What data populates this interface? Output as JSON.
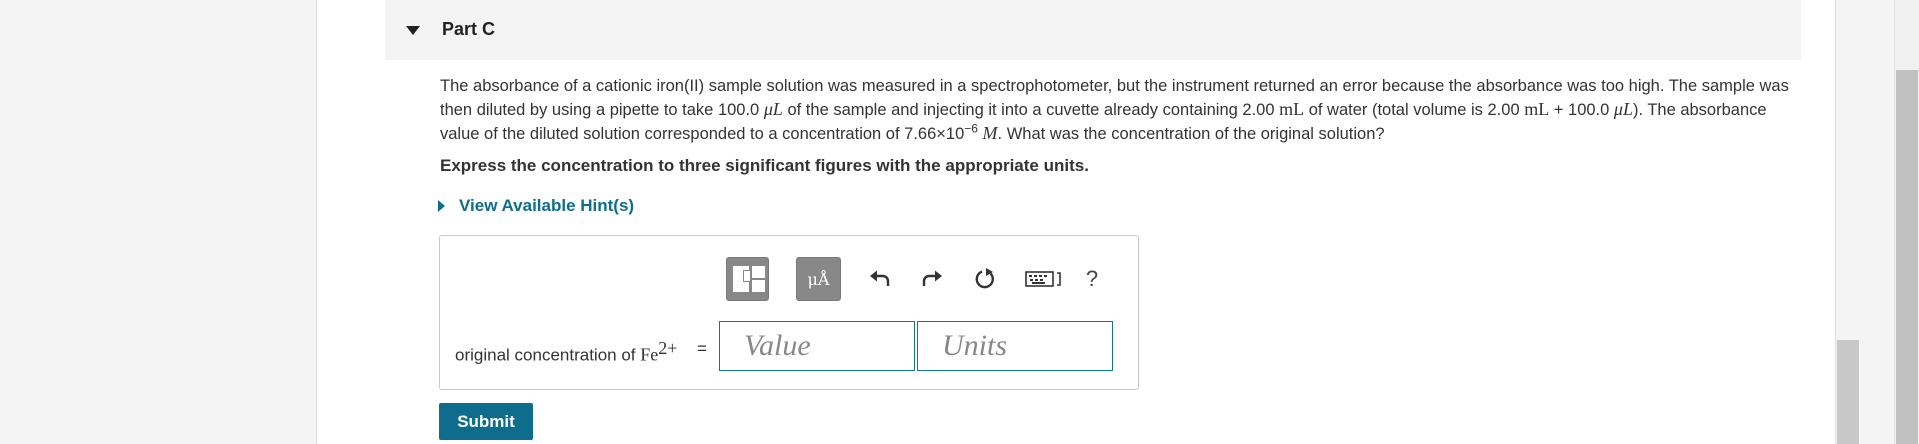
{
  "part": {
    "title": "Part C"
  },
  "question": {
    "seg1": "The absorbance of a cationic iron(II) sample solution was measured in a spectrophotometer, but the instrument returned an error because the absorbance was too high. The sample was then diluted by using a pipette to take 100.0 ",
    "unit1": "μL",
    "seg2": " of the sample and injecting it into a cuvette already containing 2.00 ",
    "unit2": "mL",
    "seg3": " of water (total volume is 2.00 ",
    "unit3": "mL",
    "seg4": " + 100.0 ",
    "unit4": "μL",
    "seg5": "). The absorbance value of the diluted solution corresponded to a concentration of 7.66×10",
    "exp": "−6",
    "unit5": "M",
    "seg6": ". What was the concentration of the original solution?"
  },
  "instruction": "Express the concentration to three significant figures with the appropriate units.",
  "hint": {
    "label": "View Available Hint(s)"
  },
  "toolbar": {
    "templates_icon": "templates-icon",
    "units_label": "μÅ",
    "undo_icon": "undo-icon",
    "redo_icon": "redo-icon",
    "reset_icon": "reset-icon",
    "keyboard_icon": "keyboard-icon",
    "help_label": "?"
  },
  "answer": {
    "label_prefix": "original concentration of ",
    "species": "Fe",
    "charge": "2+",
    "equals": "=",
    "value_placeholder": "Value",
    "units_placeholder": "Units"
  },
  "submit_label": "Submit",
  "colors": {
    "accent": "#0e6d8d",
    "toolbar_button": "#888888",
    "gutter": "#f4f4f4"
  }
}
